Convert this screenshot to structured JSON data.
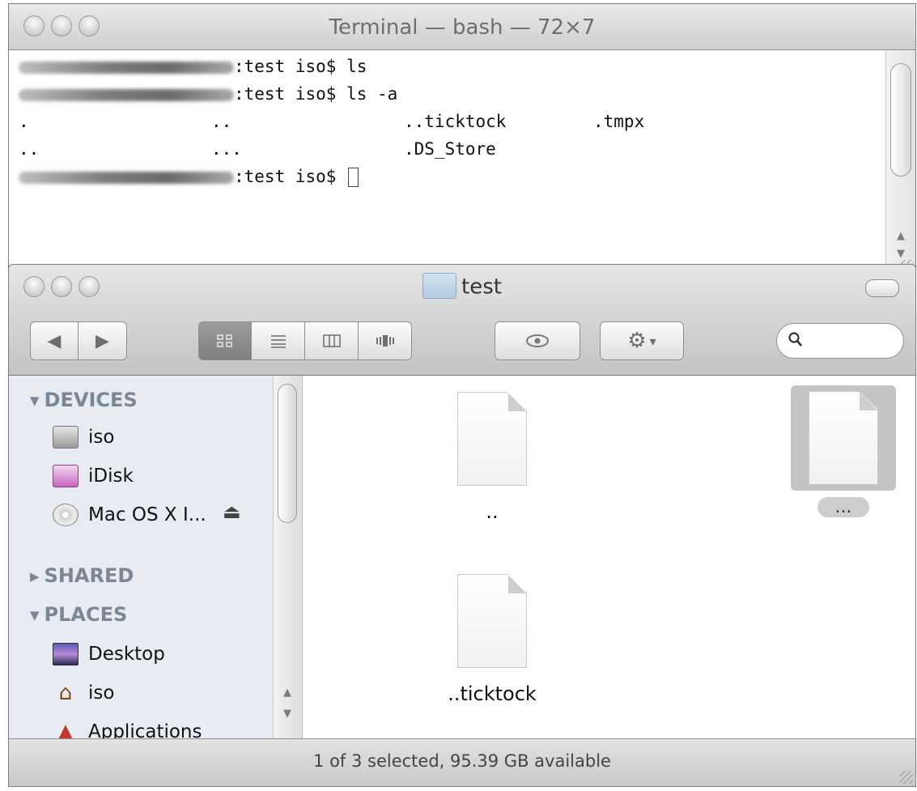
{
  "terminal": {
    "title": "Terminal — bash — 72×7",
    "lines": [
      {
        "prompt": ":test iso$",
        "command": "ls"
      },
      {
        "prompt": ":test iso$",
        "command": "ls -a"
      }
    ],
    "listing": {
      "row1": [
        ".",
        "..",
        "..ticktock",
        ".tmpx"
      ],
      "row2": [
        "..",
        "...",
        ".DS_Store"
      ]
    },
    "last_prompt": ":test iso$"
  },
  "finder": {
    "title": "test",
    "toolbar": {
      "back_icon": "◀",
      "forward_icon": "▶",
      "view_icons": "icon-view-icon",
      "view_list": "list-view-icon",
      "view_columns": "column-view-icon",
      "view_coverflow": "coverflow-view-icon",
      "quicklook_icon": "eye-icon",
      "action_icon": "gear-icon",
      "action_caret": "▾",
      "search_value": "",
      "search_placeholder": ""
    },
    "sidebar": {
      "devices_header": "DEVICES",
      "devices": [
        {
          "label": "iso",
          "icon": "hard-drive-icon"
        },
        {
          "label": "iDisk",
          "icon": "idisk-icon"
        },
        {
          "label": "Mac OS X I...",
          "icon": "cd-icon"
        }
      ],
      "shared_header": "SHARED",
      "places_header": "PLACES",
      "places": [
        {
          "label": "Desktop",
          "icon": "desktop-icon"
        },
        {
          "label": "iso",
          "icon": "home-icon"
        },
        {
          "label": "Applications",
          "icon": "applications-icon"
        }
      ]
    },
    "files": [
      {
        "name": "..",
        "selected": false
      },
      {
        "name": "...",
        "selected": true
      },
      {
        "name": "..ticktock",
        "selected": false
      }
    ],
    "status": "1 of 3 selected, 95.39 GB available"
  }
}
